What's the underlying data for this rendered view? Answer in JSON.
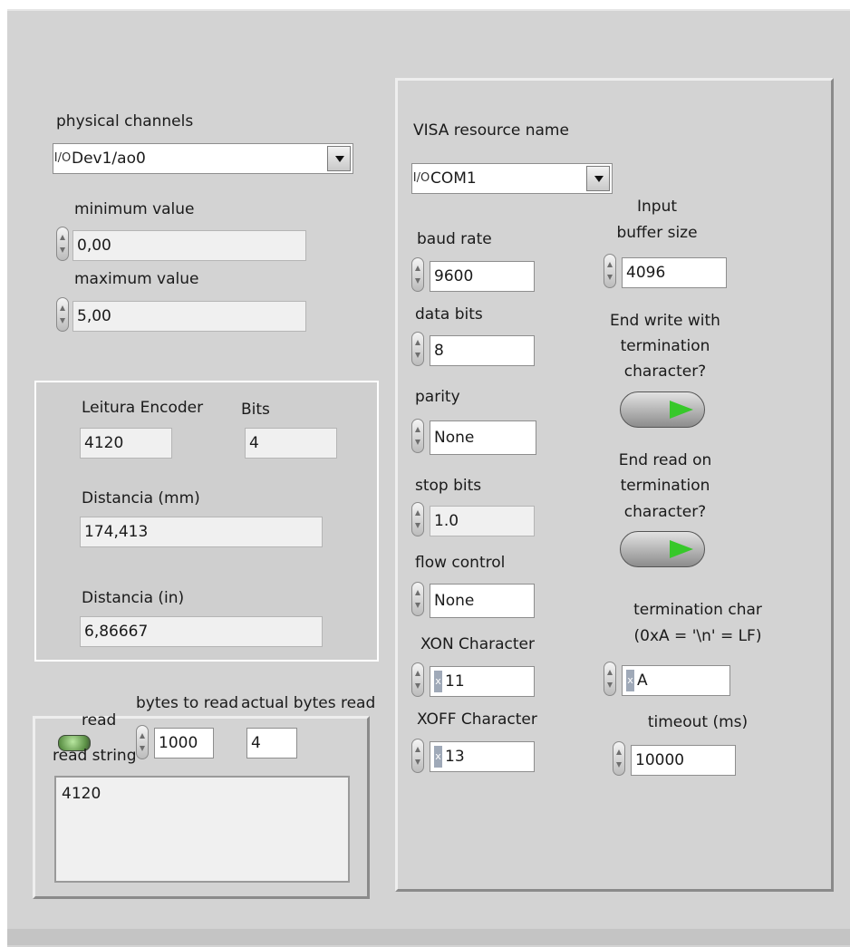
{
  "left": {
    "physical_channels_label": "physical channels",
    "physical_channels_value": "Dev1/ao0",
    "io_icon": "I/O",
    "min_label": "minimum value",
    "min_value": "0,00",
    "max_label": "maximum value",
    "max_value": "5,00"
  },
  "encoder": {
    "leitura_label": "Leitura Encoder",
    "leitura_value": "4120",
    "bits_label": "Bits",
    "bits_value": "4",
    "dist_mm_label": "Distancia (mm)",
    "dist_mm_value": "174,413",
    "dist_in_label": "Distancia (in)",
    "dist_in_value": "6,86667"
  },
  "read": {
    "read_label": "read",
    "bytes_to_read_label": "bytes to read",
    "bytes_to_read_value": "1000",
    "actual_bytes_label": "actual bytes read",
    "actual_bytes_value": "4",
    "read_string_label": "read string",
    "read_string_value": "4120"
  },
  "serial": {
    "visa_label": "VISA resource name",
    "visa_value": "COM1",
    "baud_label": "baud rate",
    "baud_value": "9600",
    "buffer_label_1": "Input",
    "buffer_label_2": "buffer size",
    "buffer_value": "4096",
    "data_bits_label": "data bits",
    "data_bits_value": "8",
    "end_write_label_1": "End write with",
    "end_write_label_2": "termination",
    "end_write_label_3": "character?",
    "parity_label": "parity",
    "parity_value": "None",
    "end_read_label_1": "End read on",
    "end_read_label_2": "termination",
    "end_read_label_3": "character?",
    "stop_bits_label": "stop bits",
    "stop_bits_value": "1.0",
    "flow_label": "flow control",
    "flow_value": "None",
    "term_char_label_1": "termination char",
    "term_char_label_2": "(0xA = '\\n' = LF)",
    "term_char_value": "A",
    "xon_label": "XON Character",
    "xon_value": "11",
    "xoff_label": "XOFF Character",
    "xoff_value": "13",
    "timeout_label": "timeout (ms)",
    "timeout_value": "10000",
    "hex_marker": "x"
  }
}
